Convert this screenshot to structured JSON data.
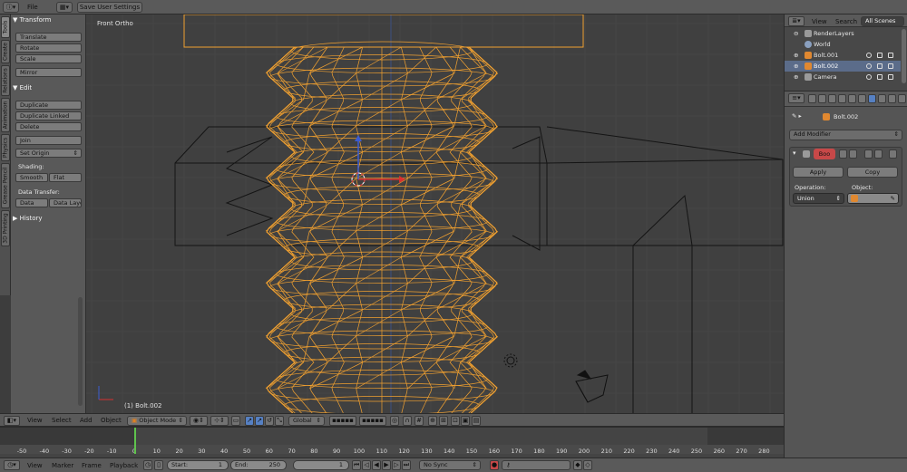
{
  "colors": {
    "selected_wire": "#f0a030",
    "dark_wire": "#111111",
    "frame_cursor": "#5fc34d",
    "red_mod": "#c84848",
    "active_tab": "#5680c2"
  },
  "top_bar": {
    "file_menu": "File",
    "save_settings": "Save User Settings"
  },
  "tool_tabs": [
    "Tools",
    "Create",
    "Relations",
    "Animation",
    "Physics",
    "Grease Pencil",
    "3D Printing"
  ],
  "tool_shelf": {
    "transform_header": "Transform",
    "translate": "Translate",
    "rotate": "Rotate",
    "scale": "Scale",
    "mirror": "Mirror",
    "edit_header": "Edit",
    "duplicate": "Duplicate",
    "duplicate_linked": "Duplicate Linked",
    "delete": "Delete",
    "join": "Join",
    "set_origin": "Set Origin",
    "shading_label": "Shading:",
    "smooth": "Smooth",
    "flat": "Flat",
    "data_transfer_label": "Data Transfer:",
    "data": "Data",
    "data_layout": "Data Layo",
    "history_header": "History"
  },
  "viewport": {
    "view_name": "Front Ortho",
    "active_object": "(1) Bolt.002"
  },
  "viewport_header": {
    "view": "View",
    "select": "Select",
    "add": "Add",
    "object": "Object",
    "mode": "Object Mode",
    "orientation": "Global"
  },
  "timeline": {
    "ticks": [
      -50,
      -40,
      -30,
      -20,
      -10,
      0,
      10,
      20,
      30,
      40,
      50,
      60,
      70,
      80,
      90,
      100,
      110,
      120,
      130,
      140,
      150,
      160,
      170,
      180,
      190,
      200,
      210,
      220,
      230,
      240,
      250,
      260,
      270,
      280
    ],
    "current_frame": "1"
  },
  "timeline_header": {
    "view": "View",
    "marker": "Marker",
    "frame": "Frame",
    "playback": "Playback",
    "start_label": "Start:",
    "start_value": "1",
    "end_label": "End:",
    "end_value": "250",
    "current": "1",
    "sync": "No Sync"
  },
  "outliner": {
    "view": "View",
    "search": "Search",
    "scenes": "All Scenes",
    "items": [
      {
        "name": "RenderLayers",
        "icon": "renderlayers-icon"
      },
      {
        "name": "World",
        "icon": "world-icon"
      },
      {
        "name": "Bolt.001",
        "icon": "mesh-icon"
      },
      {
        "name": "Bolt.002",
        "icon": "mesh-icon"
      },
      {
        "name": "Camera",
        "icon": "camera-icon"
      }
    ]
  },
  "properties": {
    "object_name": "Bolt.002",
    "add_modifier": "Add Modifier",
    "modifier_name": "Boo",
    "apply": "Apply",
    "copy": "Copy",
    "operation_label": "Operation:",
    "object_label": "Object:",
    "operation_value": "Union"
  }
}
